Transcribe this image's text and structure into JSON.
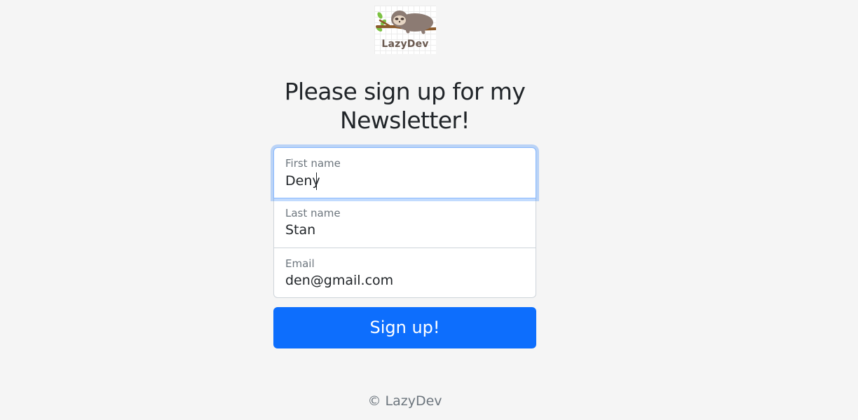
{
  "logo": {
    "text": "LazyDev",
    "icon": "sloth-icon"
  },
  "title": "Please sign up for my Newsletter!",
  "form": {
    "first_name": {
      "label": "First name",
      "value": "Deny"
    },
    "last_name": {
      "label": "Last name",
      "value": "Stan"
    },
    "email": {
      "label": "Email",
      "value": "den@gmail.com"
    },
    "submit_label": "Sign up!"
  },
  "footer": {
    "text": "© LazyDev"
  },
  "colors": {
    "background": "#f5f5f5",
    "primary": "#0d6efd",
    "focus_border": "#86b7fe",
    "muted": "#6c757d",
    "text": "#212529"
  }
}
